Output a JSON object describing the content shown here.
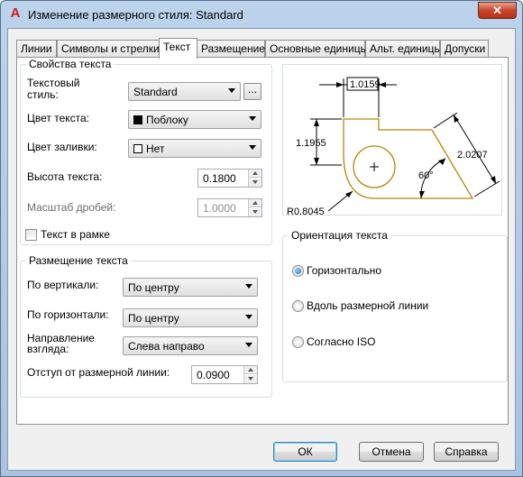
{
  "window": {
    "title": "Изменение размерного стиля: Standard",
    "app_icon": "A",
    "close_label": "✕"
  },
  "tabs": [
    {
      "label": "Линии"
    },
    {
      "label": "Символы и стрелки"
    },
    {
      "label": "Текст",
      "active": true
    },
    {
      "label": "Размещение"
    },
    {
      "label": "Основные единицы"
    },
    {
      "label": "Альт. единицы"
    },
    {
      "label": "Допуски"
    }
  ],
  "text_props": {
    "group_title": "Свойства текста",
    "style_label_line1": "Текстовый",
    "style_label_line2": "стиль:",
    "style_value": "Standard",
    "style_dots": "...",
    "color_label": "Цвет текста:",
    "color_value": "Поблоку",
    "color_swatch": "#000000",
    "fill_label": "Цвет заливки:",
    "fill_value": "Нет",
    "fill_swatch": "#ffffff",
    "height_label": "Высота текста:",
    "height_value": "0.1800",
    "fraction_label": "Масштаб дробей:",
    "fraction_value": "1.0000",
    "frame_label": "Текст в рамке",
    "frame_checked": false
  },
  "text_placement": {
    "group_title": "Размещение текста",
    "vertical_label": "По вертикали:",
    "vertical_value": "По центру",
    "horizontal_label": "По горизонтали:",
    "horizontal_value": "По центру",
    "direction_label_line1": "Направление",
    "direction_label_line2": "взгляда:",
    "direction_value": "Слева направо",
    "offset_label": "Отступ от размерной линии:",
    "offset_value": "0.0900"
  },
  "preview": {
    "dim_top": "1.0159",
    "dim_left": "1.1955",
    "dim_right": "2.0207",
    "dim_angle": "60°",
    "dim_radius": "R0.8045",
    "outline_color": "#b8860b"
  },
  "alignment": {
    "group_title": "Ориентация текста",
    "options": [
      {
        "label": "Горизонтально",
        "checked": true
      },
      {
        "label": "Вдоль размерной линии",
        "checked": false
      },
      {
        "label": "Согласно ISO",
        "checked": false
      }
    ]
  },
  "buttons": {
    "ok": "ОК",
    "cancel": "Отмена",
    "help": "Справка"
  }
}
